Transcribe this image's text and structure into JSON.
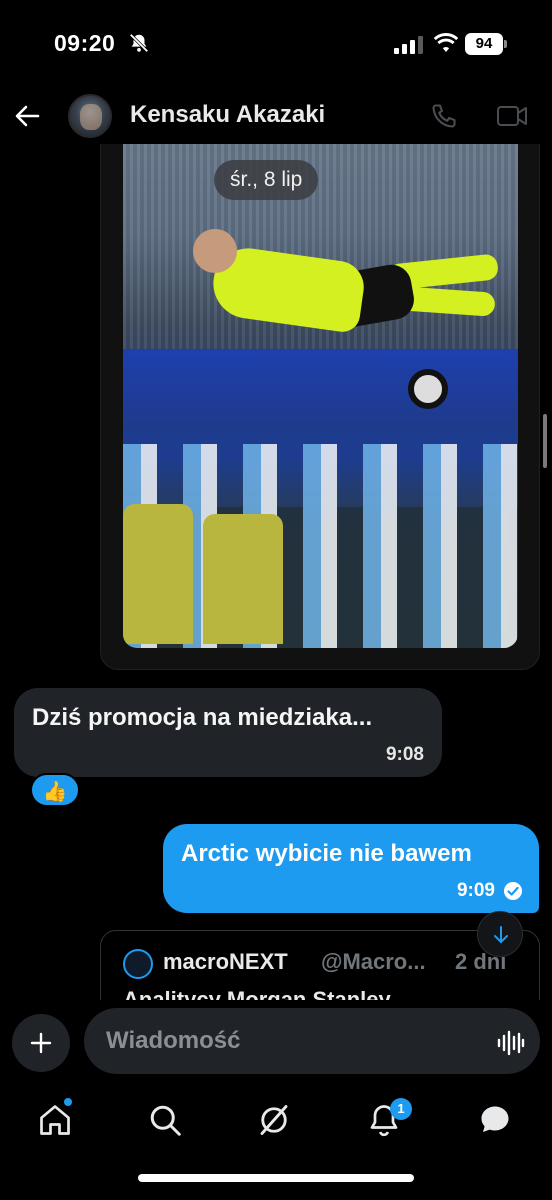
{
  "status_bar": {
    "time": "09:20",
    "battery": "94",
    "icons": [
      "bell-off-icon",
      "signal-icon",
      "wifi-icon",
      "battery-icon"
    ]
  },
  "header": {
    "contact_name": "Kensaku Akazaki",
    "icons": [
      "back-arrow-icon",
      "phone-icon",
      "video-camera-icon"
    ]
  },
  "chat": {
    "date_pill": "śr., 8 lip",
    "incoming_message": {
      "text": "Dziś promocja na miedziaka...",
      "time": "9:08",
      "reaction": "👍"
    },
    "outgoing_message": {
      "text": "Arctic wybicie nie bawem",
      "time": "9:09",
      "status": "read-check-icon"
    },
    "shared_post": {
      "author": "macroNEXT",
      "handle": "@Macro...",
      "age": "2 dni",
      "body_partial": "Analitycy Morgan Stanley"
    }
  },
  "composer": {
    "placeholder": "Wiadomość"
  },
  "bottom_nav": {
    "items": [
      "home-icon",
      "search-icon",
      "grok-icon",
      "notifications-icon",
      "messages-icon"
    ],
    "notifications_badge": "1"
  },
  "colors": {
    "accent": "#1d9bf0",
    "incoming_bubble": "#202327",
    "background": "#000000"
  }
}
